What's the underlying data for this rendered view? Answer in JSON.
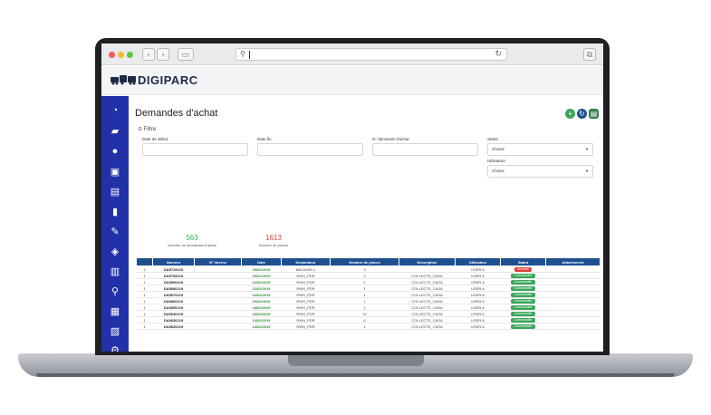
{
  "app": {
    "brand": "DIGIPARC"
  },
  "page": {
    "title": "Demandes d'achat"
  },
  "filter": {
    "toggle_label": "Filtre",
    "date_debut_label": "Date de début",
    "date_fin_label": "Date fin",
    "num_demande_label": "N° demande d'achat",
    "statut_label": "Statut",
    "statut_value": "Choisir",
    "utilisateur_label": "Utilisateur",
    "utilisateur_value": "Choisir"
  },
  "stats": {
    "demandes_count": "563",
    "demandes_label": "Nombre de demandes d'achat",
    "pieces_count": "1613",
    "pieces_label": "Nombre de pièces"
  },
  "colors": {
    "sidebar": "#2131a8",
    "green": "#3aa657",
    "red": "#e0403b",
    "header_blue": "#1e4f8f"
  },
  "table": {
    "headers": [
      "",
      "Numéro",
      "N° interne",
      "Date",
      "Demandeur",
      "Nombre de pièces",
      "Description",
      "Utilisateur",
      "Statut",
      "Attachement"
    ],
    "rows": [
      {
        "idx": "1",
        "numero": "DA5719219",
        "interne": "",
        "date": "25/02/2019",
        "demandeur": "MAGASIN 1",
        "pieces": "3",
        "description": "",
        "utilisateur": "USER A",
        "statut": "Annulée"
      },
      {
        "idx": "1",
        "numero": "DA5708219",
        "interne": "",
        "date": "25/02/2019",
        "demandeur": "RWH_PDR",
        "pieces": "2",
        "description": "COLLECTE_CASA",
        "utilisateur": "USER A",
        "statut": "Commandée"
      },
      {
        "idx": "1",
        "numero": "DA5690219",
        "interne": "",
        "date": "22/02/2019",
        "demandeur": "RWH_PDR",
        "pieces": "2",
        "description": "COLLECTE_CASA",
        "utilisateur": "USER A",
        "statut": "Commandée"
      },
      {
        "idx": "1",
        "numero": "DA5680219",
        "interne": "",
        "date": "22/02/2019",
        "demandeur": "RWH_PDR",
        "pieces": "1",
        "description": "COLLECTE_CASA",
        "utilisateur": "USER A",
        "statut": "Commandée"
      },
      {
        "idx": "1",
        "numero": "DA5670219",
        "interne": "",
        "date": "22/02/2019",
        "demandeur": "RWH_PDR",
        "pieces": "1",
        "description": "COLLECTE_CASA",
        "utilisateur": "USER A",
        "statut": "Commandée"
      },
      {
        "idx": "1",
        "numero": "DA5660219",
        "interne": "",
        "date": "20/02/2019",
        "demandeur": "RWH_PDR",
        "pieces": "1",
        "description": "COLLECTE_CASA",
        "utilisateur": "USER A",
        "statut": "Commandée"
      },
      {
        "idx": "1",
        "numero": "DA5650219",
        "interne": "",
        "date": "18/02/2019",
        "demandeur": "RWH_PDR",
        "pieces": "1",
        "description": "COLLECTE_CASA",
        "utilisateur": "USER A",
        "statut": "Commandée"
      },
      {
        "idx": "1",
        "numero": "DA5640219",
        "interne": "",
        "date": "18/02/2019",
        "demandeur": "RWH_PDR",
        "pieces": "12",
        "description": "COLLECTE_CASA",
        "utilisateur": "USER A",
        "statut": "Commandée"
      },
      {
        "idx": "1",
        "numero": "DA5630219",
        "interne": "",
        "date": "14/02/2019",
        "demandeur": "RWH_PDR",
        "pieces": "6",
        "description": "COLLECTE_CASA",
        "utilisateur": "USER A",
        "statut": "Commandée"
      },
      {
        "idx": "1",
        "numero": "DA5620219",
        "interne": "",
        "date": "14/02/2019",
        "demandeur": "RWH_PDR",
        "pieces": "1",
        "description": "COLLECTE_CASA",
        "utilisateur": "USER A",
        "statut": "Commandée"
      }
    ]
  },
  "sidebar": {
    "icons": [
      "dashboard-icon",
      "car-icon",
      "user-icon",
      "bus-icon",
      "document-icon",
      "fuel-icon",
      "wrench-icon",
      "layers-icon",
      "building-icon",
      "location-pin-icon",
      "truck-icon",
      "report-icon",
      "settings-icon"
    ]
  }
}
